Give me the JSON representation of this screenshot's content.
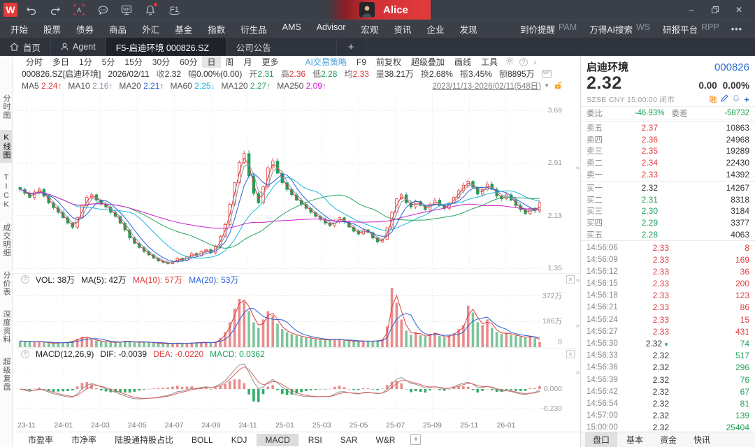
{
  "glyphs": {
    "question": "?",
    "close_small": "×",
    "chev_left": "«",
    "chev_right": "»",
    "caret_down": "▼",
    "more_dots": "•••",
    "minimize": "–",
    "close_window": "✕",
    "plus": "+",
    "arrow_right": "›",
    "f1": "F1",
    "wp": "WP",
    "down_arrow": "▼"
  },
  "titlebar": {
    "logo": "W",
    "user": "Alice",
    "icons": [
      "undo-icon",
      "redo-icon",
      "font-frame-icon",
      "chat-icon",
      "wp-monitor-icon",
      "bell-icon",
      "f1-help-icon"
    ]
  },
  "menu": {
    "left": [
      "开始",
      "股票",
      "债券",
      "商品",
      "外汇",
      "基金",
      "指数",
      "衍生品",
      "AMS",
      "Advisor",
      "宏观",
      "资讯",
      "企业",
      "发现"
    ],
    "right": [
      {
        "label": "到价提醒",
        "tag": "PAM"
      },
      {
        "label": "万得AI搜索",
        "tag": "WS"
      },
      {
        "label": "研报平台",
        "tag": "RPP"
      }
    ]
  },
  "tabs": {
    "home": "首页",
    "agent": "Agent",
    "active": "F5-启迪环境 000826.SZ",
    "announcement": "公司公告"
  },
  "siderail": {
    "items": [
      "分时图",
      "K线图",
      "TICK",
      "成交明细",
      "分价表",
      "深度资料",
      "超级复盘"
    ],
    "active": "K线图"
  },
  "chart_toolbar": {
    "periods": [
      "分时",
      "多日",
      "1分",
      "5分",
      "15分",
      "30分",
      "60分",
      "日",
      "周",
      "月",
      "更多"
    ],
    "active_period": "日",
    "right": [
      "AI交易策略",
      "F9",
      "前复权",
      "超级叠加",
      "画线",
      "工具"
    ]
  },
  "info_line": {
    "code": "000826.SZ[启迪环境]",
    "date": "2026/02/11",
    "segments": [
      {
        "label": "收",
        "value": "2.32",
        "tone": "flat"
      },
      {
        "label": "幅",
        "value": "0.00%(0.00)",
        "tone": "flat"
      },
      {
        "label": "开",
        "value": "2.31",
        "tone": "down"
      },
      {
        "label": "高",
        "value": "2.36",
        "tone": "up"
      },
      {
        "label": "低",
        "value": "2.28",
        "tone": "down"
      },
      {
        "label": "均",
        "value": "2.33",
        "tone": "up"
      },
      {
        "label": "量",
        "value": "38.21万",
        "tone": "flat"
      },
      {
        "label": "换",
        "value": "2.68%",
        "tone": "flat"
      },
      {
        "label": "振",
        "value": "3.45%",
        "tone": "flat"
      },
      {
        "label": "额",
        "value": "8895万",
        "tone": "flat"
      }
    ]
  },
  "ma_line": {
    "items": [
      {
        "label": "MA5",
        "value": "2.24",
        "arrow": "↑",
        "color": "#e23b3b"
      },
      {
        "label": "MA10",
        "value": "2.16",
        "arrow": "↑",
        "color": "#8a97a8"
      },
      {
        "label": "MA20",
        "value": "2.21",
        "arrow": "↑",
        "color": "#2b5fd9"
      },
      {
        "label": "MA60",
        "value": "2.25",
        "arrow": "↓",
        "color": "#1cb9dc"
      },
      {
        "label": "MA120",
        "value": "2.27",
        "arrow": "↑",
        "color": "#27a35c"
      },
      {
        "label": "MA250",
        "value": "2.09",
        "arrow": "↑",
        "color": "#cc22cc"
      }
    ],
    "range": "2023/11/13-2026/02/11(548日)"
  },
  "price_axis": [
    "3.69",
    "2.91",
    "2.13",
    "1.35"
  ],
  "vol_pane": {
    "vol": "VOL: 38万",
    "ma5": "MA(5): 42万",
    "ma10": "MA(10): 57万",
    "ma20": "MA(20): 53万",
    "axis": [
      "372万",
      "186万",
      "0"
    ]
  },
  "macd_pane": {
    "title": "MACD(12,26,9)",
    "dif": "DIF: -0.0039",
    "dea": "DEA: -0.0220",
    "macd": "MACD: 0.0362",
    "axis": [
      "0.000",
      "-0.230"
    ]
  },
  "x_axis": [
    "23-11",
    "24-01",
    "24-03",
    "24-05",
    "24-07",
    "24-09",
    "24-11",
    "25-01",
    "25-03",
    "25-05",
    "25-07",
    "25-09",
    "25-11",
    "26-01"
  ],
  "indicator_tabs": {
    "items": [
      "市盈率",
      "市净率",
      "陆股通持股占比",
      "BOLL",
      "KDJ",
      "MACD",
      "RSI",
      "SAR",
      "W&R"
    ],
    "active": "MACD"
  },
  "right_panel": {
    "name": "启迪环境",
    "code": "000826",
    "price": "2.32",
    "chg": "0.00",
    "chg_pct": "0.00%",
    "meta": "SZSE  CNY  15:00:00  闭市",
    "margin_flag": "融",
    "weibi_label": "委比",
    "weibi": "-46.93%",
    "weicha_label": "委差",
    "weicha": "-58732",
    "asks": [
      {
        "label": "卖五",
        "price": "2.37",
        "vol": "10863",
        "tone": "up"
      },
      {
        "label": "卖四",
        "price": "2.36",
        "vol": "24968",
        "tone": "up"
      },
      {
        "label": "卖三",
        "price": "2.35",
        "vol": "19289",
        "tone": "up"
      },
      {
        "label": "卖二",
        "price": "2.34",
        "vol": "22430",
        "tone": "up"
      },
      {
        "label": "卖一",
        "price": "2.33",
        "vol": "14392",
        "tone": "up"
      }
    ],
    "bids": [
      {
        "label": "买一",
        "price": "2.32",
        "vol": "14267",
        "tone": "flat"
      },
      {
        "label": "买二",
        "price": "2.31",
        "vol": "8318",
        "tone": "down"
      },
      {
        "label": "买三",
        "price": "2.30",
        "vol": "3184",
        "tone": "down"
      },
      {
        "label": "买四",
        "price": "2.29",
        "vol": "3377",
        "tone": "down"
      },
      {
        "label": "买五",
        "price": "2.28",
        "vol": "4063",
        "tone": "down"
      }
    ],
    "ticks": [
      {
        "time": "14:56:06",
        "price": "2.33",
        "vol": "8",
        "ptone": "up",
        "vtone": "up",
        "arrow": ""
      },
      {
        "time": "14:56:09",
        "price": "2.33",
        "vol": "169",
        "ptone": "up",
        "vtone": "up",
        "arrow": ""
      },
      {
        "time": "14:56:12",
        "price": "2.33",
        "vol": "36",
        "ptone": "up",
        "vtone": "up",
        "arrow": ""
      },
      {
        "time": "14:56:15",
        "price": "2.33",
        "vol": "200",
        "ptone": "up",
        "vtone": "up",
        "arrow": ""
      },
      {
        "time": "14:56:18",
        "price": "2.33",
        "vol": "123",
        "ptone": "up",
        "vtone": "up",
        "arrow": ""
      },
      {
        "time": "14:56:21",
        "price": "2.33",
        "vol": "86",
        "ptone": "up",
        "vtone": "up",
        "arrow": ""
      },
      {
        "time": "14:56:24",
        "price": "2.33",
        "vol": "15",
        "ptone": "up",
        "vtone": "up",
        "arrow": ""
      },
      {
        "time": "14:56:27",
        "price": "2.33",
        "vol": "431",
        "ptone": "up",
        "vtone": "up",
        "arrow": ""
      },
      {
        "time": "14:56:30",
        "price": "2.32",
        "vol": "74",
        "ptone": "flat",
        "vtone": "down",
        "arrow": "▼"
      },
      {
        "time": "14:56:33",
        "price": "2.32",
        "vol": "517",
        "ptone": "flat",
        "vtone": "down",
        "arrow": ""
      },
      {
        "time": "14:56:36",
        "price": "2.32",
        "vol": "296",
        "ptone": "flat",
        "vtone": "down",
        "arrow": ""
      },
      {
        "time": "14:56:39",
        "price": "2.32",
        "vol": "76",
        "ptone": "flat",
        "vtone": "down",
        "arrow": ""
      },
      {
        "time": "14:56:42",
        "price": "2.32",
        "vol": "67",
        "ptone": "flat",
        "vtone": "down",
        "arrow": ""
      },
      {
        "time": "14:56:54",
        "price": "2.32",
        "vol": "81",
        "ptone": "flat",
        "vtone": "down",
        "arrow": ""
      },
      {
        "time": "14:57:00",
        "price": "2.32",
        "vol": "139",
        "ptone": "flat",
        "vtone": "down",
        "arrow": ""
      },
      {
        "time": "15:00:00",
        "price": "2.32",
        "vol": "25404",
        "ptone": "flat",
        "vtone": "down",
        "arrow": ""
      }
    ],
    "tabs": {
      "items": [
        "盘口",
        "基本",
        "资金",
        "快讯"
      ],
      "active": "盘口"
    }
  },
  "colors": {
    "up_red": "#e23b3b",
    "down_green": "#1fa05a",
    "blue": "#2b5fd9",
    "cyan": "#1cb9dc",
    "magenta": "#cc22cc",
    "green_ma": "#27a35c",
    "gray_ma": "#8a97a8",
    "accent_blue": "#2b6bd4"
  },
  "chart_data": {
    "type": "candlestick",
    "title": "000826.SZ 启迪环境 日K 2023/11/13-2026/02/11",
    "x_labels": [
      "23-11",
      "24-01",
      "24-03",
      "24-05",
      "24-07",
      "24-09",
      "24-11",
      "25-01",
      "25-03",
      "25-05",
      "25-07",
      "25-09",
      "25-11",
      "26-01"
    ],
    "price_range": [
      1.28,
      3.97
    ],
    "closes": [
      2.52,
      2.46,
      2.4,
      2.48,
      2.52,
      2.42,
      2.32,
      2.25,
      2.18,
      2.1,
      2.02,
      1.96,
      2.1,
      2.28,
      2.4,
      2.44,
      2.36,
      2.3,
      2.26,
      2.18,
      2.12,
      2.02,
      1.92,
      1.8,
      1.72,
      1.66,
      1.6,
      1.55,
      1.5,
      1.46,
      1.44,
      1.42,
      1.45,
      1.5,
      1.47,
      1.52,
      1.57,
      1.54,
      1.6,
      1.63,
      1.58,
      1.68,
      1.82,
      2.0,
      2.3,
      2.62,
      2.92,
      3.05,
      2.72,
      2.46,
      2.32,
      2.56,
      2.84,
      2.94,
      2.76,
      2.62,
      2.52,
      2.44,
      2.36,
      2.3,
      2.24,
      2.18,
      2.12,
      2.08,
      2.02,
      1.98,
      2.05,
      2.1,
      2.04,
      1.96,
      1.9,
      1.86,
      1.92,
      1.88,
      1.8,
      1.74,
      1.78,
      1.95,
      2.18,
      2.38,
      2.44,
      2.32,
      2.26,
      2.34,
      2.28,
      2.22,
      2.3,
      2.36,
      2.28,
      2.24,
      2.32,
      2.4,
      2.5,
      2.58,
      2.64,
      2.55,
      2.45,
      2.52,
      2.6,
      2.52,
      2.42,
      2.38,
      2.44,
      2.36,
      2.28,
      2.22,
      2.16,
      2.24,
      2.2,
      2.32
    ],
    "volumes": [
      45,
      38,
      42,
      36,
      40,
      35,
      30,
      28,
      32,
      32,
      38,
      45,
      60,
      75,
      70,
      55,
      48,
      40,
      38,
      35,
      33,
      38,
      45,
      40,
      36,
      34,
      38,
      35,
      30,
      28,
      26,
      25,
      28,
      30,
      26,
      28,
      32,
      32,
      36,
      34,
      30,
      40,
      65,
      110,
      180,
      280,
      350,
      330,
      260,
      180,
      140,
      200,
      260,
      230,
      170,
      130,
      110,
      95,
      85,
      75,
      70,
      64,
      58,
      55,
      52,
      50,
      58,
      54,
      48,
      45,
      42,
      40,
      46,
      42,
      44,
      48,
      55,
      150,
      430,
      320,
      200,
      120,
      90,
      110,
      85,
      75,
      95,
      105,
      80,
      70,
      85,
      100,
      130,
      160,
      300,
      250,
      180,
      160,
      200,
      140,
      110,
      95,
      105,
      90,
      85,
      75,
      70,
      80,
      65,
      38
    ],
    "volume_unit": "万"
  }
}
